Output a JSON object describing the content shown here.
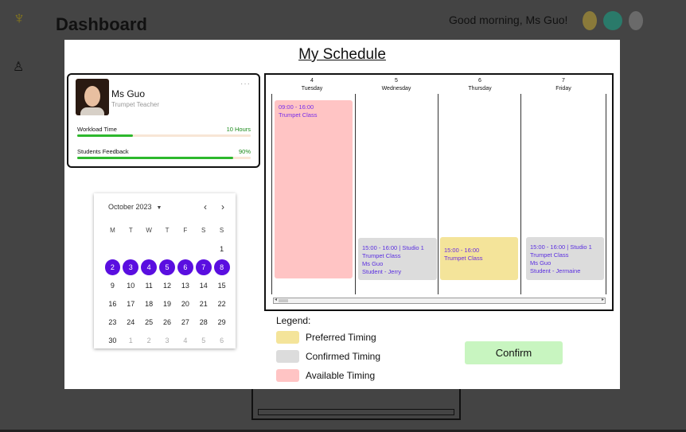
{
  "background": {
    "title": "Dashboard",
    "greeting": "Good morning, Ms Guo!"
  },
  "modal": {
    "title": "My Schedule"
  },
  "profile": {
    "name": "Ms Guo",
    "role": "Trumpet Teacher",
    "more": "···",
    "metrics": [
      {
        "label": "Workload Time",
        "value": "10 Hours",
        "fill": 0.32
      },
      {
        "label": "Students Feedback",
        "value": "90%",
        "fill": 0.9
      }
    ]
  },
  "calendar": {
    "month": "October 2023",
    "prev": "‹",
    "next": "›",
    "caret": "▼",
    "weekdays": [
      "M",
      "T",
      "W",
      "T",
      "F",
      "S",
      "S"
    ],
    "weeks": [
      [
        "",
        "",
        "",
        "",
        "",
        "",
        "1"
      ],
      [
        "2",
        "3",
        "4",
        "5",
        "6",
        "7",
        "8"
      ],
      [
        "9",
        "10",
        "11",
        "12",
        "13",
        "14",
        "15"
      ],
      [
        "16",
        "17",
        "18",
        "19",
        "20",
        "21",
        "22"
      ],
      [
        "23",
        "24",
        "25",
        "26",
        "27",
        "28",
        "29"
      ],
      [
        "30",
        "1",
        "2",
        "3",
        "4",
        "5",
        "6"
      ]
    ]
  },
  "schedule": {
    "days": [
      {
        "date": "4",
        "weekday": "Tuesday"
      },
      {
        "date": "5",
        "weekday": "Wednesday"
      },
      {
        "date": "6",
        "weekday": "Thursday"
      },
      {
        "date": "7",
        "weekday": "Friday"
      }
    ],
    "events": {
      "available_tue": {
        "time": "09:00 - 16:00",
        "title": "Trumpet Class"
      },
      "confirmed_wed": {
        "time": "15:00 - 16:00 | Studio 1",
        "title": "Trumpet Class",
        "teacher": "Ms Guo",
        "student": "Student - Jerry"
      },
      "preferred_thu": {
        "time": "15:00 - 16:00",
        "title": "Trumpet Class"
      },
      "confirmed_fri": {
        "time": "15:00 - 16:00 | Studio 1",
        "title": "Trumpet Class",
        "teacher": "Ms Guo",
        "student": "Student - Jermaine"
      }
    },
    "scroll_left": "◂",
    "scroll_right": "▸"
  },
  "legend": {
    "title": "Legend:",
    "items": [
      {
        "label": "Preferred Timing",
        "color": "#f4e49a"
      },
      {
        "label": "Confirmed Timing",
        "color": "#dcdcdc"
      },
      {
        "label": "Available Timing",
        "color": "#ffc4c4"
      }
    ]
  },
  "actions": {
    "confirm_label": "Confirm"
  }
}
